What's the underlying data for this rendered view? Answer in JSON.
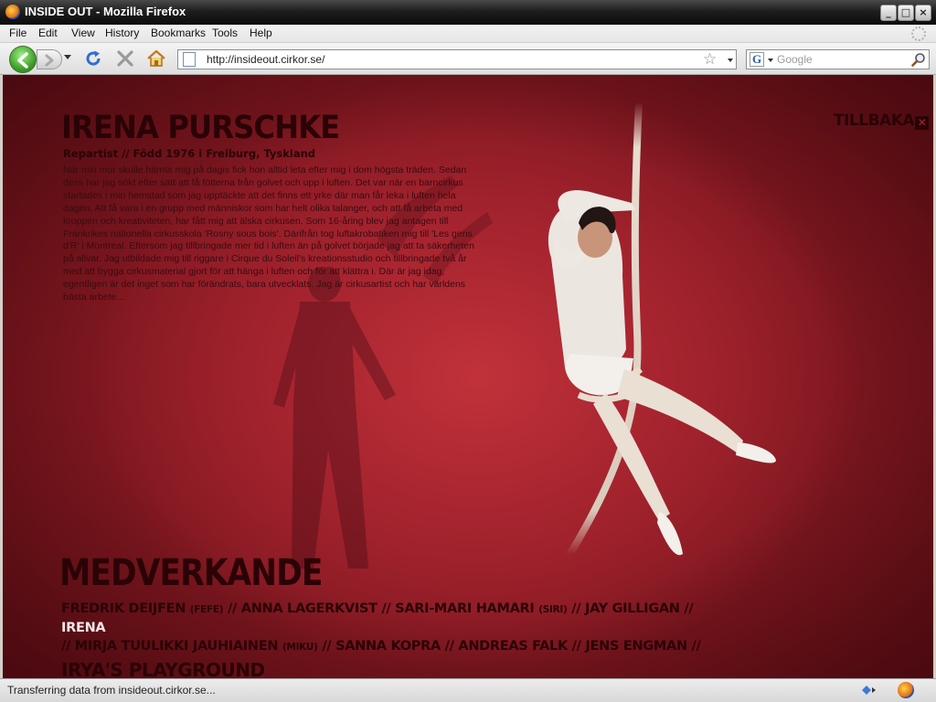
{
  "window": {
    "title": "INSIDE OUT - Mozilla Firefox",
    "controls": {
      "minimize": "_",
      "maximize": "□",
      "close": "×"
    }
  },
  "menu": [
    "File",
    "Edit",
    "View",
    "History",
    "Bookmarks",
    "Tools",
    "Help"
  ],
  "toolbar": {
    "icons": [
      "back-icon",
      "forward-icon",
      "reload-icon",
      "stop-icon",
      "home-icon"
    ]
  },
  "address": {
    "url": "http://insideout.cirkor.se/"
  },
  "search": {
    "engine_letter": "G",
    "placeholder": "Google"
  },
  "page": {
    "name": "IRENA PURSCHKE",
    "subtitle": "Repartist // Född 1976 i Freiburg, Tyskland",
    "bio": "När min mor skulle hämta mig på dagis fick hon alltid leta efter mig i dom högsta träden. Sedan dess har jag sökt efter sätt att få fötterna från golvet och upp i luften. Det var när en barncirkus startades i min hemstad som jag upptäckte att det finns ett yrke där man får leka i luften hela dagen. Att få vara i en grupp med människor som har helt olika talanger, och att få arbeta med kroppen och kreativiteten, har fått mig att älska cirkusen. Som 16-åring blev jag antagen till Frankrikes nationella cirkusskola 'Rosny sous bois'. Därifrån tog luftakrobatiken mig till 'Les gens d'R' i Montreal. Eftersom jag tillbringade mer tid i luften än på golvet började jag att ta säkerheten på allvar. Jag utbildade mig till riggare i Cirque du Soleil's kreationsstudio och tillbringade två år med att bygga cirkusmaterial gjort för att hänga i luften och  för att klättra i. Där är jag idag, egentligen är det inget som har förändrats, bara utvecklats. Jag är cirkusartist och har världens bästa arbete...",
    "back_label": "TILLBAKA",
    "credits_title": "MEDVERKANDE",
    "credits": {
      "p1": "FREDRIK DEIJFEN",
      "p1_nick": "(FEFE)",
      "p2": "ANNA LAGERKVIST",
      "p3": "SARI-MARI HAMARI",
      "p3_nick": "(SIRI)",
      "p4": "JAY GILLIGAN",
      "p5": "IRENA",
      "p6": "MIRJA TUULIKKI JAUHIAINEN",
      "p6_nick": "(MIKU)",
      "p7": "SANNA  KOPRA",
      "p8": "ANDREAS FALK",
      "p9": "JENS ENGMAN",
      "p10": "IRYA'S PLAYGROUND",
      "separator": "//"
    }
  },
  "status": {
    "text": "Transferring data from insideout.cirkor.se..."
  }
}
